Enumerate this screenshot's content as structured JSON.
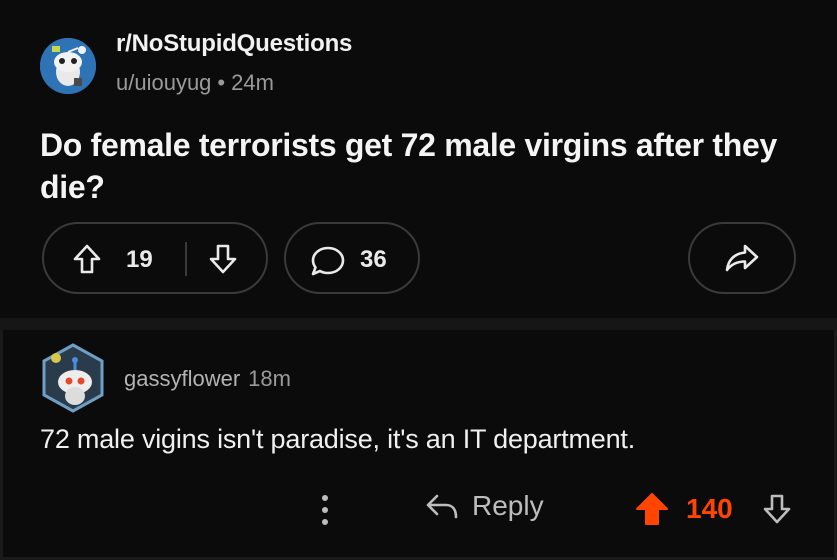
{
  "post": {
    "subreddit": "r/NoStupidQuestions",
    "author": "u/uiouyug",
    "separator": "•",
    "age": "24m",
    "title": "Do female terrorists get 72 male virgins after they die?",
    "upvotes": "19",
    "comments": "36"
  },
  "comment": {
    "username": "gassyflower",
    "age": "18m",
    "body": "72 male vigins isn't paradise, it's an IT department.",
    "reply_label": "Reply",
    "score": "140"
  },
  "colors": {
    "background": "#0b0b0b",
    "upvote_active": "#ff4500",
    "muted_text": "#9a9a9a",
    "pill_border": "#3a3a3a"
  },
  "icons": [
    "upvote-arrow-icon",
    "downvote-arrow-icon",
    "comment-bubble-icon",
    "share-icon",
    "more-options-icon",
    "reply-icon"
  ]
}
